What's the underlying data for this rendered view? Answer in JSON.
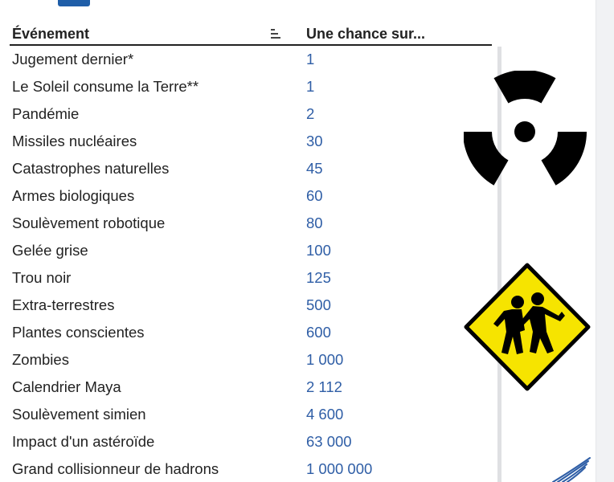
{
  "table": {
    "headers": {
      "event": "Événement",
      "odds": "Une chance sur..."
    },
    "rows": [
      {
        "event": "Jugement dernier*",
        "odds": "1"
      },
      {
        "event": "Le Soleil consume la Terre**",
        "odds": "1"
      },
      {
        "event": "Pandémie",
        "odds": "2"
      },
      {
        "event": "Missiles nucléaires",
        "odds": "30"
      },
      {
        "event": "Catastrophes naturelles",
        "odds": "45"
      },
      {
        "event": "Armes biologiques",
        "odds": "60"
      },
      {
        "event": "Soulèvement robotique",
        "odds": "80"
      },
      {
        "event": "Gelée grise",
        "odds": "100"
      },
      {
        "event": "Trou noir",
        "odds": "125"
      },
      {
        "event": "Extra-terrestres",
        "odds": "500"
      },
      {
        "event": "Plantes conscientes",
        "odds": "600"
      },
      {
        "event": "Zombies",
        "odds": "1 000"
      },
      {
        "event": "Calendrier Maya",
        "odds": "2 112"
      },
      {
        "event": "Soulèvement simien",
        "odds": "4 600"
      },
      {
        "event": "Impact d'un astéroïde",
        "odds": "63 000"
      },
      {
        "event": "Grand collisionneur de hadrons",
        "odds": "1 000 000"
      }
    ]
  },
  "icons": {
    "radiation": "radiation-icon",
    "zombie": "zombie-warning-icon",
    "corner_logo": "logo-icon",
    "sort": "sort-icon"
  },
  "colors": {
    "value_text": "#2f5ea6",
    "header_rule": "#222222",
    "warning_yellow": "#f6e400"
  }
}
